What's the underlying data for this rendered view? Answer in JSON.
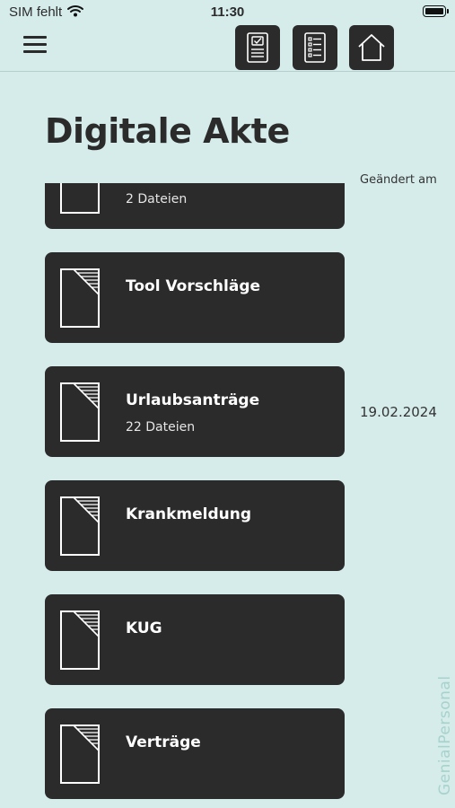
{
  "status_bar": {
    "carrier": "SIM fehlt",
    "time": "11:30"
  },
  "header": {
    "title": "Digitale Akte",
    "changed_label": "Geändert am"
  },
  "folders": [
    {
      "title": "",
      "count": "2 Dateien",
      "date": ""
    },
    {
      "title": "Tool Vorschläge",
      "count": "",
      "date": ""
    },
    {
      "title": "Urlaubsanträge",
      "count": "22 Dateien",
      "date": "19.02.2024"
    },
    {
      "title": "Krankmeldung",
      "count": "",
      "date": ""
    },
    {
      "title": "KUG",
      "count": "",
      "date": ""
    },
    {
      "title": "Verträge",
      "count": "",
      "date": ""
    }
  ],
  "watermark": "GenialPersonal",
  "icons": [
    "wifi-icon",
    "battery-icon",
    "menu-icon",
    "checked-document-icon",
    "list-document-icon",
    "home-icon",
    "folder-file-icon"
  ],
  "colors": {
    "background": "#d5ecea",
    "card": "#2b2b2b",
    "card_text": "#ffffff",
    "watermark": "#a8d2cd"
  }
}
